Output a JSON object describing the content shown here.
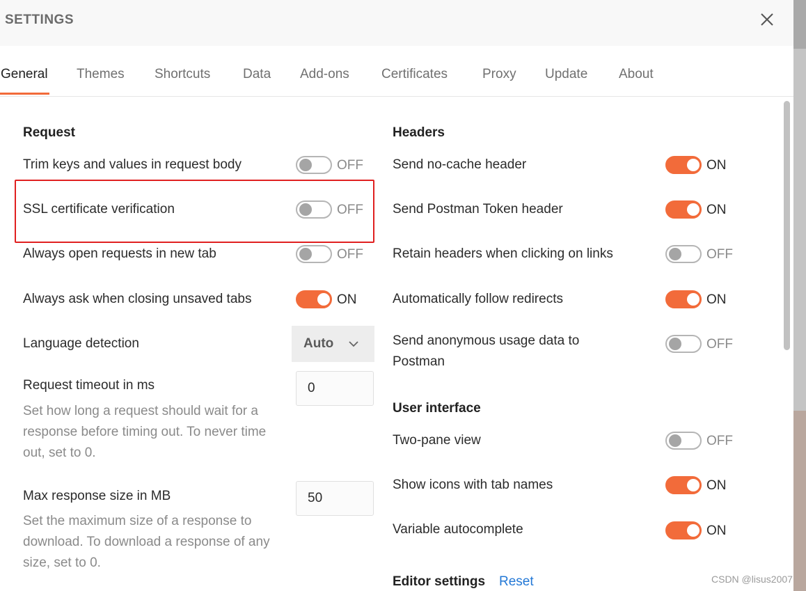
{
  "modal": {
    "title": "SETTINGS"
  },
  "tabs": [
    {
      "label": "General",
      "active": true
    },
    {
      "label": "Themes"
    },
    {
      "label": "Shortcuts"
    },
    {
      "label": "Data"
    },
    {
      "label": "Add-ons"
    },
    {
      "label": "Certificates"
    },
    {
      "label": "Proxy"
    },
    {
      "label": "Update"
    },
    {
      "label": "About"
    }
  ],
  "request": {
    "title": "Request",
    "trim_keys": {
      "label": "Trim keys and values in request body",
      "state": "OFF"
    },
    "ssl_verification": {
      "label": "SSL certificate verification",
      "state": "OFF"
    },
    "open_in_new_tab": {
      "label": "Always open requests in new tab",
      "state": "OFF"
    },
    "ask_closing_unsaved": {
      "label": "Always ask when closing unsaved tabs",
      "state": "ON"
    },
    "language_detection": {
      "label": "Language detection",
      "value": "Auto"
    },
    "request_timeout": {
      "label": "Request timeout in ms",
      "description": "Set how long a request should wait for a response before timing out. To never time out, set to 0.",
      "value": "0"
    },
    "max_response_size": {
      "label": "Max response size in MB",
      "description": "Set the maximum size of a response to download. To download a response of any size, set to 0.",
      "value": "50"
    }
  },
  "headers": {
    "title": "Headers",
    "no_cache": {
      "label": "Send no-cache header",
      "state": "ON"
    },
    "postman_token": {
      "label": "Send Postman Token header",
      "state": "ON"
    },
    "retain_headers": {
      "label": "Retain headers when clicking on links",
      "state": "OFF"
    },
    "follow_redirects": {
      "label": "Automatically follow redirects",
      "state": "ON"
    },
    "anonymous_usage": {
      "label_line1": "Send anonymous usage data to",
      "label_line2": "Postman",
      "state": "OFF"
    }
  },
  "user_interface": {
    "title": "User interface",
    "two_pane": {
      "label": "Two-pane view",
      "state": "OFF"
    },
    "icons_tab_names": {
      "label": "Show icons with tab names",
      "state": "ON"
    },
    "variable_autocomplete": {
      "label": "Variable autocomplete",
      "state": "ON"
    }
  },
  "editor_settings": {
    "title": "Editor settings",
    "reset_label": "Reset"
  },
  "watermark": "CSDN @lisus2007",
  "colors": {
    "accent": "#f26b3a",
    "highlight": "#e02020",
    "link": "#2378d6"
  },
  "icons": {
    "close": "close-icon",
    "chevron": "chevron-down-icon"
  }
}
